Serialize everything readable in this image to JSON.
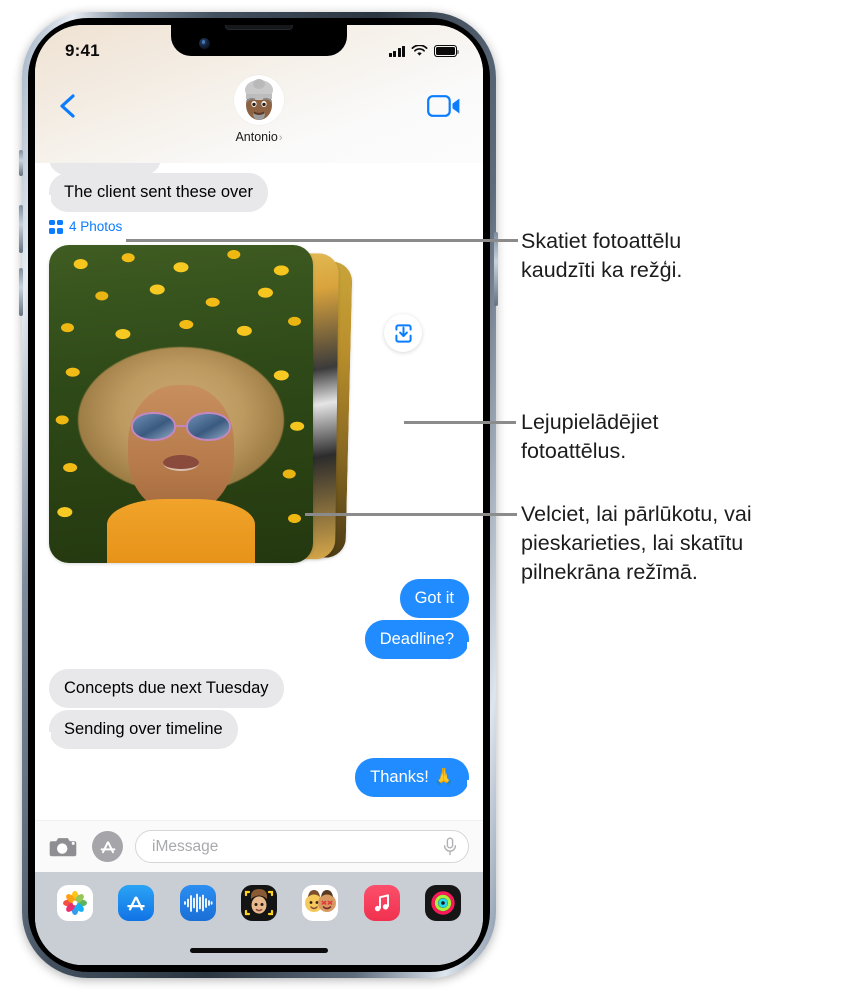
{
  "status_bar": {
    "time": "9:41",
    "cellular_icon": "cellular-bars-icon",
    "wifi_icon": "wifi-icon",
    "battery_icon": "battery-icon"
  },
  "header": {
    "back_icon": "back-chevron-icon",
    "facetime_icon": "video-camera-icon",
    "contact_name": "Antonio",
    "contact_chevron": "›",
    "avatar_icon": "memoji-avatar"
  },
  "conversation": {
    "photos_attachment": {
      "icon": "grid-icon",
      "label": "4 Photos"
    },
    "download_button": {
      "icon": "save-to-photos-icon"
    },
    "messages": [
      {
        "text": "The client sent these over",
        "side": "incoming"
      },
      {
        "text": "Got it",
        "side": "outgoing"
      },
      {
        "text": "Deadline?",
        "side": "outgoing"
      },
      {
        "text": "Concepts due next Tuesday",
        "side": "incoming"
      },
      {
        "text": "Sending over timeline",
        "side": "incoming"
      },
      {
        "text": "Thanks! 🙏",
        "side": "outgoing"
      }
    ]
  },
  "input_bar": {
    "camera_icon": "camera-icon",
    "apps_icon": "app-store-icon",
    "placeholder": "iMessage",
    "mic_icon": "microphone-icon"
  },
  "app_drawer": {
    "items": [
      {
        "name": "photos-app-icon",
        "label": "Photos"
      },
      {
        "name": "app-store-app-icon",
        "label": "App Store"
      },
      {
        "name": "digital-touch-app-icon",
        "label": "Digital Touch"
      },
      {
        "name": "memoji-app-icon",
        "label": "Memoji"
      },
      {
        "name": "stickers-app-icon",
        "label": "Memoji Stickers"
      },
      {
        "name": "music-app-icon",
        "label": "Music"
      },
      {
        "name": "fitness-app-icon",
        "label": "Fitness"
      }
    ]
  },
  "callouts": [
    {
      "id": "grid-callout",
      "line1": "Skatiet fotoattēlu",
      "line2": "kaudzīti ka režģi.",
      "line3": ""
    },
    {
      "id": "download-callout",
      "line1": "Lejupielādējiet",
      "line2": "fotoattēlus.",
      "line3": ""
    },
    {
      "id": "swipe-callout",
      "line1": "Velciet, lai pārlūkotu, vai",
      "line2": "pieskarieties, lai skatītu",
      "line3": "pilnekrāna režīmā."
    }
  ],
  "colors": {
    "accent_blue": "#0a7cff",
    "bubble_blue": "#208cff",
    "bubble_gray": "#e8e8ea",
    "drawer_gray": "#c9cdd4",
    "leader_gray": "#8b8b8b"
  }
}
